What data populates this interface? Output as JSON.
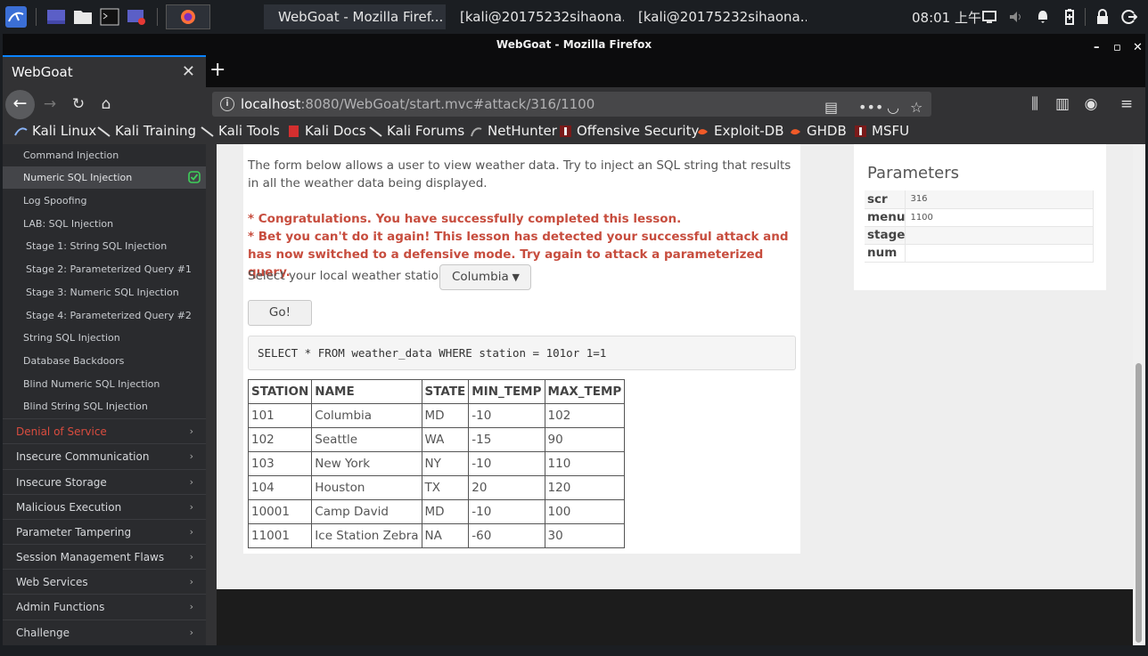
{
  "taskbar": {
    "tasks": [
      {
        "label": "WebGoat - Mozilla Firef...",
        "icon": "firefox-icon"
      },
      {
        "label": "[kali@20175232sihaona...",
        "icon": "terminal-icon"
      },
      {
        "label": "[kali@20175232sihaona...",
        "icon": "terminal-icon"
      }
    ],
    "clock": "08:01 上午"
  },
  "browser": {
    "window_title": "WebGoat - Mozilla Firefox",
    "tab_title": "WebGoat",
    "url_host": "localhost",
    "url_rest": ":8080/WebGoat/start.mvc#attack/316/1100",
    "bookmarks": [
      "Kali Linux",
      "Kali Training",
      "Kali Tools",
      "Kali Docs",
      "Kali Forums",
      "NetHunter",
      "Offensive Security",
      "Exploit-DB",
      "GHDB",
      "MSFU"
    ]
  },
  "sidebar": {
    "items": [
      {
        "label": "Command Injection",
        "stage": false,
        "selected": false
      },
      {
        "label": "Numeric SQL Injection",
        "stage": false,
        "selected": true,
        "completed": true
      },
      {
        "label": "Log Spoofing",
        "stage": false,
        "selected": false
      },
      {
        "label": "LAB: SQL Injection",
        "stage": false,
        "selected": false
      },
      {
        "label": "Stage 1: String SQL Injection",
        "stage": true,
        "selected": false
      },
      {
        "label": "Stage 2: Parameterized Query #1",
        "stage": true,
        "selected": false
      },
      {
        "label": "Stage 3: Numeric SQL Injection",
        "stage": true,
        "selected": false
      },
      {
        "label": "Stage 4: Parameterized Query #2",
        "stage": true,
        "selected": false
      },
      {
        "label": "String SQL Injection",
        "stage": false,
        "selected": false
      },
      {
        "label": "Database Backdoors",
        "stage": false,
        "selected": false
      },
      {
        "label": "Blind Numeric SQL Injection",
        "stage": false,
        "selected": false
      },
      {
        "label": "Blind String SQL Injection",
        "stage": false,
        "selected": false
      }
    ],
    "categories": [
      {
        "label": "Denial of Service",
        "active": true
      },
      {
        "label": "Insecure Communication",
        "active": false
      },
      {
        "label": "Insecure Storage",
        "active": false
      },
      {
        "label": "Malicious Execution",
        "active": false
      },
      {
        "label": "Parameter Tampering",
        "active": false
      },
      {
        "label": "Session Management Flaws",
        "active": false
      },
      {
        "label": "Web Services",
        "active": false
      },
      {
        "label": "Admin Functions",
        "active": false
      },
      {
        "label": "Challenge",
        "active": false
      }
    ]
  },
  "lesson": {
    "intro": "The form below allows a user to view weather data. Try to inject an SQL string that results in all the weather data being displayed.",
    "success_1": "* Congratulations. You have successfully completed this lesson.",
    "success_2": "* Bet you can't do it again! This lesson has detected your successful attack and has now switched to a defensive mode. Try again to attack a parameterized query.",
    "station_label": "Select your local weather station:",
    "station_value": "Columbia",
    "go_label": "Go!",
    "query": "SELECT * FROM weather_data WHERE station = 101or 1=1",
    "table": {
      "headers": [
        "STATION",
        "NAME",
        "STATE",
        "MIN_TEMP",
        "MAX_TEMP"
      ],
      "rows": [
        [
          "101",
          "Columbia",
          "MD",
          "-10",
          "102"
        ],
        [
          "102",
          "Seattle",
          "WA",
          "-15",
          "90"
        ],
        [
          "103",
          "New York",
          "NY",
          "-10",
          "110"
        ],
        [
          "104",
          "Houston",
          "TX",
          "20",
          "120"
        ],
        [
          "10001",
          "Camp David",
          "MD",
          "-10",
          "100"
        ],
        [
          "11001",
          "Ice Station Zebra",
          "NA",
          "-60",
          "30"
        ]
      ]
    }
  },
  "parameters": {
    "title": "Parameters",
    "rows": [
      {
        "key": "scr",
        "value": "316"
      },
      {
        "key": "menu",
        "value": "1100"
      },
      {
        "key": "stage",
        "value": ""
      },
      {
        "key": "num",
        "value": ""
      }
    ]
  },
  "colors": {
    "accent": "#0a84ff",
    "success_text": "#c74d3e",
    "completed_check": "#3ecf5a"
  }
}
